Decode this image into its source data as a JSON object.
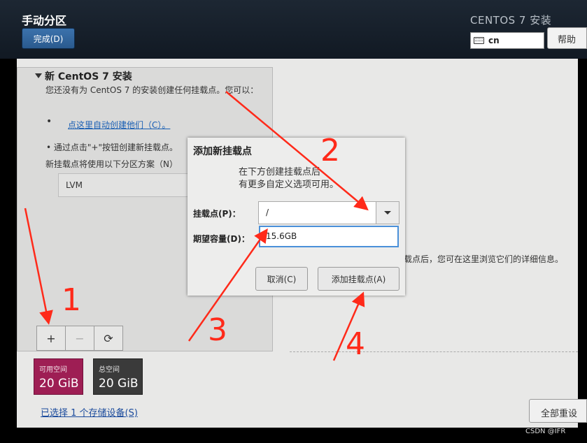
{
  "header": {
    "page_title": "手动分区",
    "done_label": "完成(D)",
    "product_title": "CENTOS 7 安装",
    "keyboard_layout": "cn",
    "help_label": "帮助"
  },
  "left_panel": {
    "heading": "新 CentOS 7 安装",
    "description": "您还没有为 CentOS 7 的安装创建任何挂载点。您可以：",
    "bullet_symbol": "•",
    "auto_create_link": "点这里自动创建他们（C）。",
    "manual_hint": "• 通过点击\"+\"按钮创建新挂载点。",
    "scheme_label": "新挂载点将使用以下分区方案（N）",
    "scheme_value": "LVM",
    "toolbar": {
      "add": "+",
      "remove": "−",
      "refresh": "⟳"
    }
  },
  "storage": {
    "available_label": "可用空间",
    "available_value": "20 GiB",
    "total_label": "总空间",
    "total_value": "20 GiB",
    "selected_devices_link": "已选择 1 个存储设备(S)",
    "available_color": "#9e1e54",
    "total_color": "#3a3a3a"
  },
  "right_panel": {
    "info_text": "挂载点后，您可在这里浏览它们的详细信息。",
    "reset_label": "全部重设"
  },
  "dialog": {
    "title": "添加新挂载点",
    "message_line1": "在下方创建挂载点后",
    "message_line2": "有更多自定义选项可用。",
    "mount_point_label": "挂载点(P)：",
    "mount_point_value": "/",
    "capacity_label": "期望容量(D)：",
    "capacity_value": "15.6GB",
    "cancel_label": "取消(C)",
    "add_label": "添加挂载点(A)"
  },
  "annotations": {
    "color": "#ff2a1a",
    "numbers": [
      "1",
      "2",
      "3",
      "4"
    ]
  },
  "watermark": "CSDN @IFR"
}
